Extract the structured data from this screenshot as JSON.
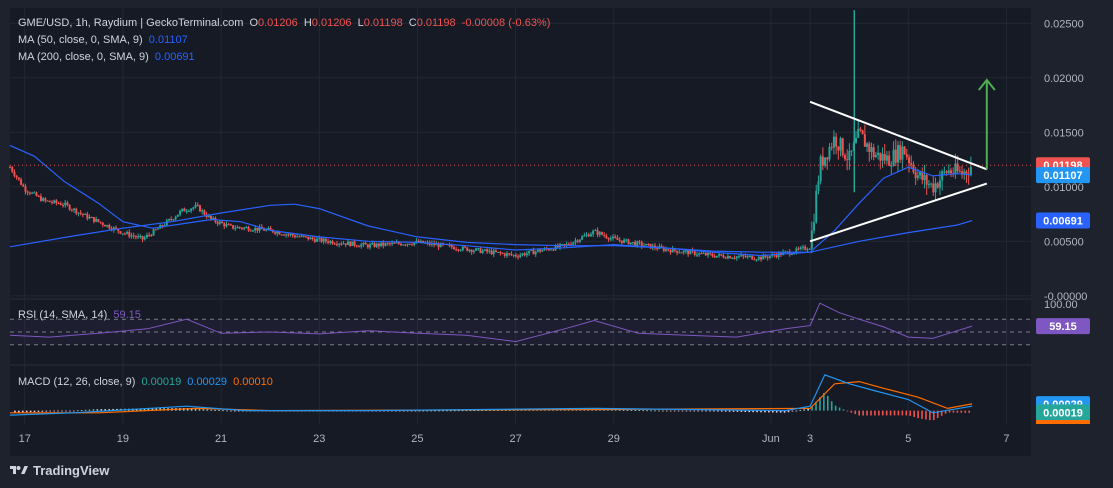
{
  "header": {
    "symbol": "GME/USD, 1h, Raydium | GeckoTerminal.com",
    "open_label": "O",
    "open": "0.01206",
    "high_label": "H",
    "high": "0.01206",
    "low_label": "L",
    "low": "0.01198",
    "close_label": "C",
    "close": "0.01198",
    "change": "-0.00008 (-0.63%)"
  },
  "ma50": {
    "label": "MA (50, close, 0, SMA, 9)",
    "value": "0.01107"
  },
  "ma200": {
    "label": "MA (200, close, 0, SMA, 9)",
    "value": "0.00691"
  },
  "rsi": {
    "label": "RSI (14, SMA, 14)",
    "value": "59.15"
  },
  "macd": {
    "label": "MACD (12, 26, close, 9)",
    "macd": "0.00019",
    "signal": "0.00029",
    "hist": "0.00010"
  },
  "brand": "TradingView",
  "colors": {
    "up": "#26a69a",
    "down": "#ef5350",
    "ma50": "#2962ff",
    "ma200": "#2962ff",
    "rsi": "#7e57c2",
    "macd_line": "#2196f3",
    "signal_line": "#ff6d00",
    "arrow": "#4caf50"
  },
  "chart_data": [
    {
      "type": "candlestick",
      "title": "GME/USD, 1h, Raydium | GeckoTerminal.com",
      "x_ticks": [
        "17",
        "19",
        "21",
        "23",
        "25",
        "27",
        "29",
        "Jun",
        "3",
        "5",
        "7"
      ],
      "x_range_days": [
        16.7,
        37.5
      ],
      "y_ticks": [
        "0.02500",
        "0.02000",
        "0.01500",
        "0.01000",
        "0.00500",
        "-0.00000"
      ],
      "ylim": [
        -0.0002,
        0.0264
      ],
      "price_markers": [
        {
          "label": "close",
          "value": "0.01198"
        },
        {
          "label": "MA 50",
          "value": "0.01107"
        },
        {
          "label": "MA 200",
          "value": "0.00691"
        }
      ],
      "close_series": [
        {
          "day": 16.7,
          "value": 0.0118
        },
        {
          "day": 17.0,
          "value": 0.0098
        },
        {
          "day": 17.4,
          "value": 0.0087
        },
        {
          "day": 17.8,
          "value": 0.0084
        },
        {
          "day": 18.2,
          "value": 0.0074
        },
        {
          "day": 18.6,
          "value": 0.0066
        },
        {
          "day": 19.0,
          "value": 0.0058
        },
        {
          "day": 19.4,
          "value": 0.0052
        },
        {
          "day": 19.8,
          "value": 0.0064
        },
        {
          "day": 20.2,
          "value": 0.0078
        },
        {
          "day": 20.5,
          "value": 0.0082
        },
        {
          "day": 20.8,
          "value": 0.007
        },
        {
          "day": 21.2,
          "value": 0.0063
        },
        {
          "day": 21.6,
          "value": 0.0062
        },
        {
          "day": 22.0,
          "value": 0.006
        },
        {
          "day": 22.5,
          "value": 0.0055
        },
        {
          "day": 23.0,
          "value": 0.0051
        },
        {
          "day": 24.0,
          "value": 0.0046
        },
        {
          "day": 25.0,
          "value": 0.0049
        },
        {
          "day": 26.0,
          "value": 0.0043
        },
        {
          "day": 27.0,
          "value": 0.0037
        },
        {
          "day": 28.0,
          "value": 0.0046
        },
        {
          "day": 28.6,
          "value": 0.0059
        },
        {
          "day": 29.0,
          "value": 0.0052
        },
        {
          "day": 30.0,
          "value": 0.0043
        },
        {
          "day": 31.0,
          "value": 0.0037
        },
        {
          "day": 32.0,
          "value": 0.0035
        },
        {
          "day": 32.7,
          "value": 0.0041
        },
        {
          "day": 33.0,
          "value": 0.0045
        },
        {
          "day": 33.2,
          "value": 0.012
        },
        {
          "day": 33.5,
          "value": 0.0145
        },
        {
          "day": 33.8,
          "value": 0.0125
        },
        {
          "day": 34.0,
          "value": 0.0148
        },
        {
          "day": 34.3,
          "value": 0.013
        },
        {
          "day": 34.6,
          "value": 0.0125
        },
        {
          "day": 34.9,
          "value": 0.0135
        },
        {
          "day": 35.2,
          "value": 0.011
        },
        {
          "day": 35.5,
          "value": 0.01
        },
        {
          "day": 35.8,
          "value": 0.0115
        },
        {
          "day": 36.1,
          "value": 0.0112
        },
        {
          "day": 36.3,
          "value": 0.012
        }
      ],
      "ma50_series": [
        {
          "day": 16.7,
          "value": 0.0138
        },
        {
          "day": 17.2,
          "value": 0.0128
        },
        {
          "day": 17.8,
          "value": 0.0105
        },
        {
          "day": 18.5,
          "value": 0.0085
        },
        {
          "day": 19.0,
          "value": 0.0068
        },
        {
          "day": 19.6,
          "value": 0.0062
        },
        {
          "day": 20.2,
          "value": 0.0066
        },
        {
          "day": 20.8,
          "value": 0.007
        },
        {
          "day": 21.4,
          "value": 0.0068
        },
        {
          "day": 22.0,
          "value": 0.006
        },
        {
          "day": 23.0,
          "value": 0.0054
        },
        {
          "day": 24.0,
          "value": 0.005
        },
        {
          "day": 25.0,
          "value": 0.0049
        },
        {
          "day": 26.0,
          "value": 0.0046
        },
        {
          "day": 27.0,
          "value": 0.0042
        },
        {
          "day": 28.0,
          "value": 0.0044
        },
        {
          "day": 29.0,
          "value": 0.0047
        },
        {
          "day": 30.0,
          "value": 0.0044
        },
        {
          "day": 31.0,
          "value": 0.004
        },
        {
          "day": 32.0,
          "value": 0.0037
        },
        {
          "day": 33.0,
          "value": 0.004
        },
        {
          "day": 33.5,
          "value": 0.006
        },
        {
          "day": 34.0,
          "value": 0.0085
        },
        {
          "day": 34.5,
          "value": 0.0108
        },
        {
          "day": 35.0,
          "value": 0.0118
        },
        {
          "day": 35.5,
          "value": 0.011
        },
        {
          "day": 36.0,
          "value": 0.0112
        },
        {
          "day": 36.3,
          "value": 0.0111
        }
      ],
      "ma200_series": [
        {
          "day": 16.7,
          "value": 0.0045
        },
        {
          "day": 18.0,
          "value": 0.0055
        },
        {
          "day": 19.0,
          "value": 0.0062
        },
        {
          "day": 20.0,
          "value": 0.0068
        },
        {
          "day": 21.0,
          "value": 0.0076
        },
        {
          "day": 22.0,
          "value": 0.0083
        },
        {
          "day": 22.5,
          "value": 0.0084
        },
        {
          "day": 23.0,
          "value": 0.008
        },
        {
          "day": 24.0,
          "value": 0.0064
        },
        {
          "day": 25.0,
          "value": 0.0054
        },
        {
          "day": 26.0,
          "value": 0.0049
        },
        {
          "day": 27.0,
          "value": 0.0047
        },
        {
          "day": 28.0,
          "value": 0.0046
        },
        {
          "day": 29.0,
          "value": 0.0046
        },
        {
          "day": 30.0,
          "value": 0.0044
        },
        {
          "day": 31.0,
          "value": 0.0041
        },
        {
          "day": 32.0,
          "value": 0.004
        },
        {
          "day": 33.0,
          "value": 0.004
        },
        {
          "day": 34.0,
          "value": 0.005
        },
        {
          "day": 35.0,
          "value": 0.0058
        },
        {
          "day": 36.0,
          "value": 0.0065
        },
        {
          "day": 36.3,
          "value": 0.0069
        }
      ],
      "annotations": [
        {
          "type": "trendline",
          "from": {
            "day": 33.0,
            "value": 0.0178
          },
          "to": {
            "day": 36.6,
            "value": 0.0116
          }
        },
        {
          "type": "trendline",
          "from": {
            "day": 33.0,
            "value": 0.005
          },
          "to": {
            "day": 36.6,
            "value": 0.0103
          }
        },
        {
          "type": "arrow",
          "from": {
            "day": 36.6,
            "value": 0.0116
          },
          "to": {
            "day": 36.6,
            "value": 0.0198
          }
        }
      ]
    },
    {
      "type": "line",
      "title": "RSI (14, SMA, 14)",
      "y_ticks": [
        "100.00"
      ],
      "ylim": [
        0,
        100
      ],
      "bands": [
        70,
        50,
        30
      ],
      "last_value": "59.15",
      "series": [
        {
          "day": 16.7,
          "value": 45
        },
        {
          "day": 17.5,
          "value": 42
        },
        {
          "day": 18.5,
          "value": 48
        },
        {
          "day": 19.5,
          "value": 55
        },
        {
          "day": 20.3,
          "value": 70
        },
        {
          "day": 21.0,
          "value": 48
        },
        {
          "day": 22.0,
          "value": 50
        },
        {
          "day": 23.0,
          "value": 47
        },
        {
          "day": 24.0,
          "value": 52
        },
        {
          "day": 25.0,
          "value": 48
        },
        {
          "day": 26.0,
          "value": 45
        },
        {
          "day": 27.0,
          "value": 35
        },
        {
          "day": 28.0,
          "value": 55
        },
        {
          "day": 28.6,
          "value": 68
        },
        {
          "day": 29.5,
          "value": 48
        },
        {
          "day": 30.5,
          "value": 45
        },
        {
          "day": 31.5,
          "value": 42
        },
        {
          "day": 32.5,
          "value": 55
        },
        {
          "day": 33.0,
          "value": 60
        },
        {
          "day": 33.2,
          "value": 95
        },
        {
          "day": 33.6,
          "value": 80
        },
        {
          "day": 34.0,
          "value": 70
        },
        {
          "day": 34.5,
          "value": 58
        },
        {
          "day": 35.0,
          "value": 42
        },
        {
          "day": 35.5,
          "value": 40
        },
        {
          "day": 36.0,
          "value": 52
        },
        {
          "day": 36.3,
          "value": 59.15
        }
      ]
    },
    {
      "type": "line",
      "title": "MACD (12, 26, close, 9)",
      "ylim": [
        -0.0006,
        0.002
      ],
      "markers": [
        {
          "label": "signal",
          "value": "0.00029"
        },
        {
          "label": "MACD",
          "value": "0.00019"
        },
        {
          "label": "hist",
          "value": "0.00010"
        }
      ],
      "macd_series": [
        {
          "day": 16.7,
          "value": -0.0002
        },
        {
          "day": 18.0,
          "value": -0.0001
        },
        {
          "day": 20.3,
          "value": 0.0002
        },
        {
          "day": 21.5,
          "value": 0.0
        },
        {
          "day": 24.0,
          "value": 0.0
        },
        {
          "day": 28.6,
          "value": 0.0001
        },
        {
          "day": 32.5,
          "value": 0.0
        },
        {
          "day": 33.0,
          "value": 0.0002
        },
        {
          "day": 33.3,
          "value": 0.0016
        },
        {
          "day": 33.8,
          "value": 0.0012
        },
        {
          "day": 34.3,
          "value": 0.0009
        },
        {
          "day": 35.0,
          "value": 0.0005
        },
        {
          "day": 35.5,
          "value": -0.0001
        },
        {
          "day": 36.3,
          "value": 0.0002
        }
      ],
      "signal_series": [
        {
          "day": 16.7,
          "value": -0.0001
        },
        {
          "day": 18.5,
          "value": -0.0001
        },
        {
          "day": 20.5,
          "value": 0.0001
        },
        {
          "day": 22.0,
          "value": 0.0
        },
        {
          "day": 28.8,
          "value": 5e-05
        },
        {
          "day": 33.0,
          "value": 0.0001
        },
        {
          "day": 33.5,
          "value": 0.0012
        },
        {
          "day": 34.0,
          "value": 0.0013
        },
        {
          "day": 34.5,
          "value": 0.001
        },
        {
          "day": 35.2,
          "value": 0.0006
        },
        {
          "day": 35.8,
          "value": 0.0001
        },
        {
          "day": 36.3,
          "value": 0.0003
        }
      ]
    }
  ]
}
